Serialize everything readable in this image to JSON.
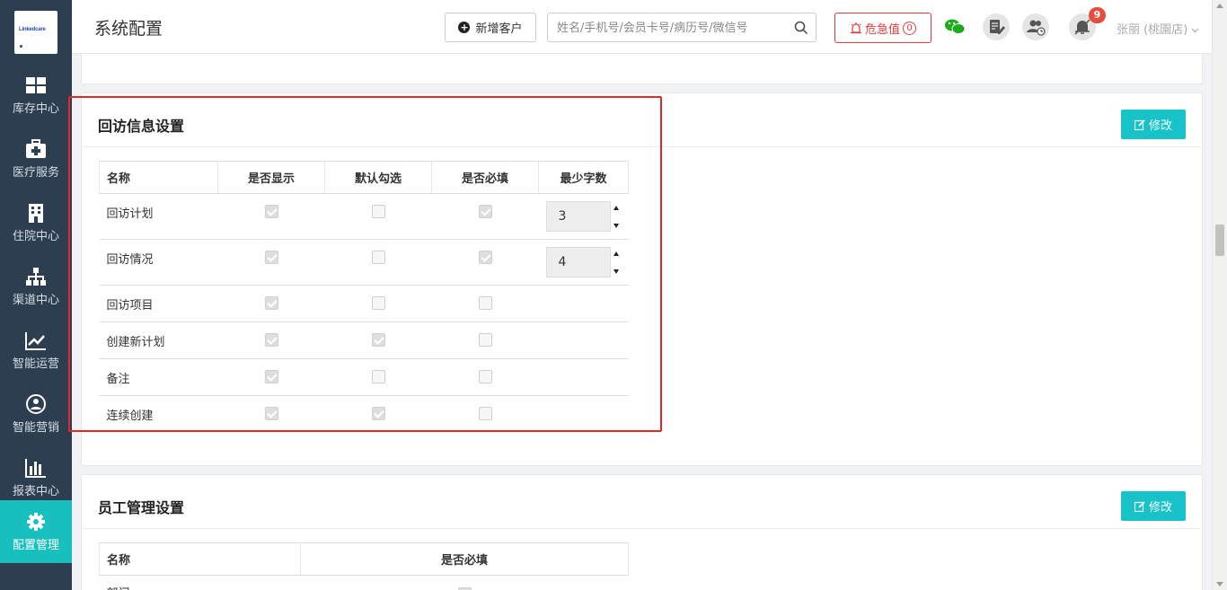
{
  "app": {
    "logo_text": "Linkedcare"
  },
  "sidebar": {
    "items": [
      {
        "label": "库存中心",
        "icon": "grid-icon"
      },
      {
        "label": "医疗服务",
        "icon": "medical-kit-icon"
      },
      {
        "label": "住院中心",
        "icon": "hospital-building-icon"
      },
      {
        "label": "渠道中心",
        "icon": "org-chart-icon"
      },
      {
        "label": "智能运营",
        "icon": "trend-chart-icon"
      },
      {
        "label": "智能营销",
        "icon": "marketing-users-icon"
      },
      {
        "label": "报表中心",
        "icon": "bar-chart-icon"
      },
      {
        "label": "配置管理",
        "icon": "gear-icon",
        "active": true
      }
    ]
  },
  "header": {
    "title": "系统配置",
    "add_customer_label": "新增客户",
    "search_placeholder": "姓名/手机号/会员卡号/病历号/微信号",
    "danger_label": "危急值",
    "danger_count": "0",
    "notification_count": "9",
    "user_name": "张丽 (桃園店)"
  },
  "followup": {
    "title": "回访信息设置",
    "edit_label": "修改",
    "columns": [
      "名称",
      "是否显示",
      "默认勾选",
      "是否必填",
      "最少字数"
    ],
    "rows": [
      {
        "name": "回访计划",
        "show": true,
        "default": false,
        "required": true,
        "min_chars": "3"
      },
      {
        "name": "回访情况",
        "show": true,
        "default": false,
        "required": true,
        "min_chars": "4"
      },
      {
        "name": "回访项目",
        "show": true,
        "default": false,
        "required": false,
        "min_chars": null
      },
      {
        "name": "创建新计划",
        "show": true,
        "default": true,
        "required": false,
        "min_chars": null
      },
      {
        "name": "备注",
        "show": true,
        "default": false,
        "required": false,
        "min_chars": null
      },
      {
        "name": "连续创建",
        "show": true,
        "default": true,
        "required": false,
        "min_chars": null
      }
    ]
  },
  "staff": {
    "title": "员工管理设置",
    "edit_label": "修改",
    "columns": [
      "名称",
      "是否必填"
    ],
    "rows": [
      {
        "name": "部门",
        "required": true
      }
    ]
  },
  "colors": {
    "accent": "#17c3c9",
    "sidebar_bg": "#2c3e50",
    "danger": "#e23b3b",
    "highlight": "#e02a2a"
  }
}
